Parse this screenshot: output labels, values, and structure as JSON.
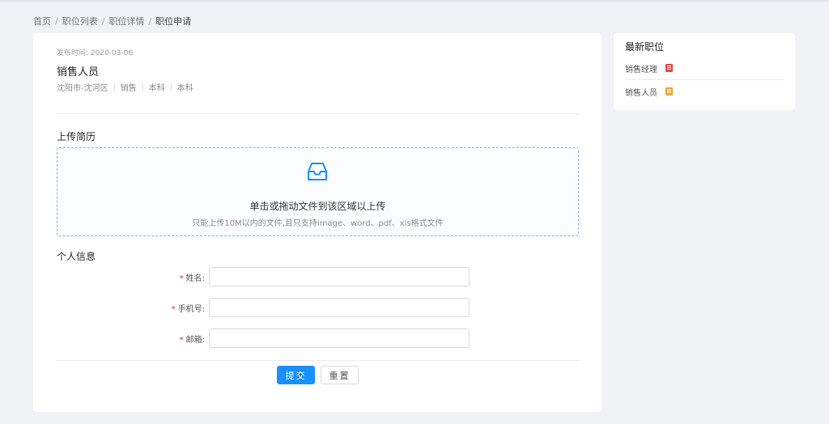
{
  "breadcrumb": {
    "items": [
      "首页",
      "职位列表",
      "职位详情"
    ],
    "current": "职位申请",
    "separator": "/"
  },
  "job": {
    "publish_date": "发布时间: 2020-03-06",
    "title": "销售人员",
    "meta": [
      "沈阳市-沈河区",
      "销售",
      "本科",
      "本科"
    ]
  },
  "upload": {
    "section_title": "上传简历",
    "icon": "inbox-icon",
    "main_text": "单击或拖动文件到该区域以上传",
    "hint_text": "只能上传10M以内的文件,且只支持image、word、pdf、xls格式文件"
  },
  "personal": {
    "section_title": "个人信息",
    "fields": [
      {
        "label": "姓名",
        "value": "",
        "placeholder": ""
      },
      {
        "label": "手机号",
        "value": "",
        "placeholder": ""
      },
      {
        "label": "邮箱",
        "value": "",
        "placeholder": ""
      }
    ],
    "required_mark": "*",
    "colon": ":"
  },
  "actions": {
    "submit_label": "提交",
    "reset_label": "重置"
  },
  "sidebar": {
    "title": "最新职位",
    "items": [
      {
        "label": "销售经理",
        "badge_color": "#e8473b",
        "icon": "hot-badge-icon"
      },
      {
        "label": "销售人员",
        "badge_color": "#f0a236",
        "icon": "new-badge-icon"
      }
    ]
  },
  "colors": {
    "primary": "#1890ff",
    "required": "#f5222d",
    "upload_border": "#7fb6f0",
    "background": "#f0f2f5"
  }
}
